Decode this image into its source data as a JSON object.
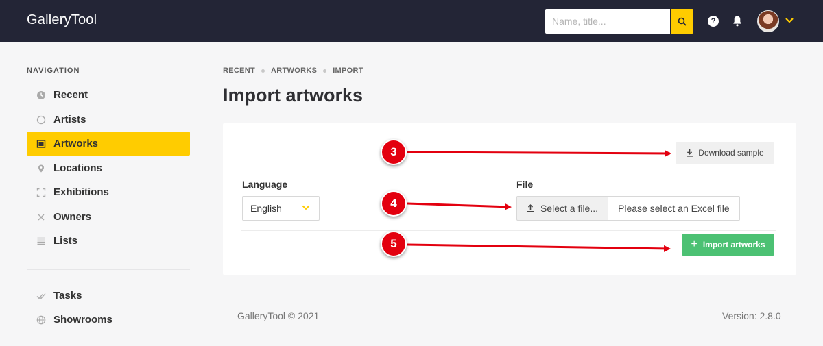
{
  "header": {
    "brand": "GalleryTool",
    "search_placeholder": "Name, title..."
  },
  "sidebar": {
    "heading": "NAVIGATION",
    "items": [
      {
        "label": "Recent",
        "icon": "clock-icon"
      },
      {
        "label": "Artists",
        "icon": "circle-icon"
      },
      {
        "label": "Artworks",
        "icon": "image-icon",
        "active": true
      },
      {
        "label": "Locations",
        "icon": "map-pin-icon"
      },
      {
        "label": "Exhibitions",
        "icon": "frame-icon"
      },
      {
        "label": "Owners",
        "icon": "x-icon"
      },
      {
        "label": "Lists",
        "icon": "list-icon"
      }
    ],
    "secondary_items": [
      {
        "label": "Tasks",
        "icon": "check-icon"
      },
      {
        "label": "Showrooms",
        "icon": "globe-icon"
      }
    ]
  },
  "breadcrumb": [
    "RECENT",
    "ARTWORKS",
    "IMPORT"
  ],
  "main": {
    "title": "Import artworks",
    "download_label": "Download sample",
    "language_label": "Language",
    "language_value": "English",
    "file_label": "File",
    "select_file_label": "Select a file...",
    "file_placeholder": "Please select an Excel file",
    "import_label": "Import artworks"
  },
  "annotations": {
    "step_3": "3",
    "step_4": "4",
    "step_5": "5"
  },
  "footer": {
    "copyright": "GalleryTool © 2021",
    "version": "Version: 2.8.0"
  },
  "colors": {
    "topbar": "#232536",
    "accent": "#ffcc00",
    "success": "#4cc173",
    "annotation": "#e3000f"
  }
}
